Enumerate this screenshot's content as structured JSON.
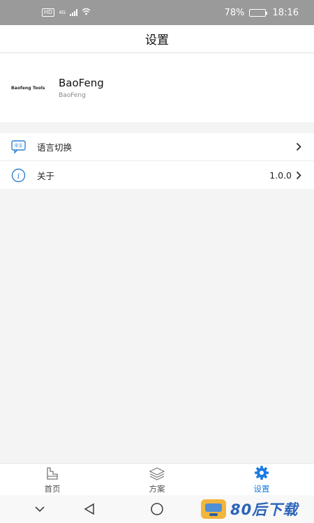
{
  "status_bar": {
    "network": "HD",
    "signal_label": "4G",
    "battery_percent": "78%",
    "battery_level": 0.78,
    "time": "18:16"
  },
  "header": {
    "title": "设置"
  },
  "profile": {
    "logo_text": "Baofeng Tools",
    "name": "BaoFeng",
    "subtitle": "BaoFeng"
  },
  "settings": {
    "items": [
      {
        "icon": "language-icon",
        "label": "语言切换",
        "value": ""
      },
      {
        "icon": "info-icon",
        "label": "关于",
        "value": "1.0.0"
      }
    ]
  },
  "bottom_nav": {
    "items": [
      {
        "icon": "home-icon",
        "label": "首页",
        "active": false
      },
      {
        "icon": "layers-icon",
        "label": "方案",
        "active": false
      },
      {
        "icon": "gear-icon",
        "label": "设置",
        "active": true
      }
    ]
  },
  "colors": {
    "accent": "#1a7be0",
    "status_bar": "#9a9a9a",
    "background": "#f4f4f4"
  },
  "watermark": {
    "text": "80后下载"
  }
}
